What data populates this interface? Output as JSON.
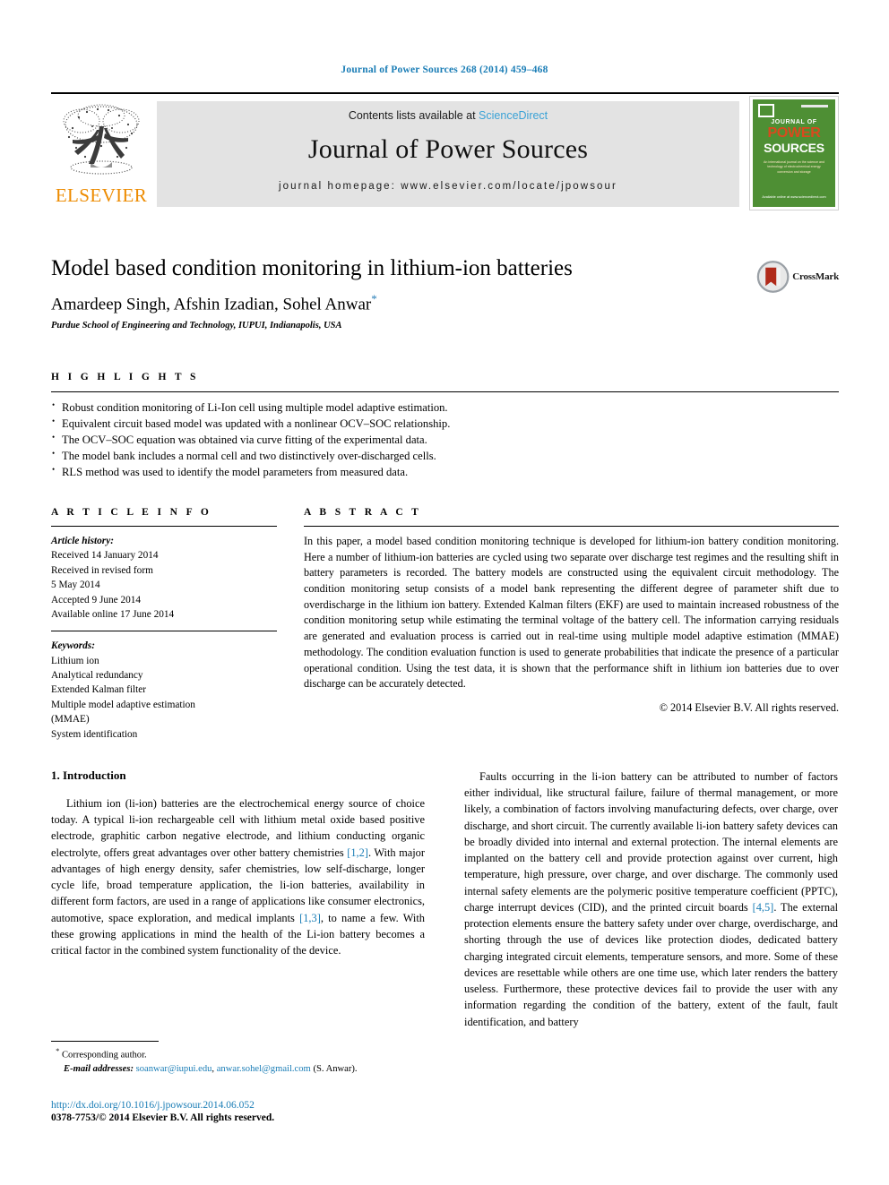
{
  "running_head": "Journal of Power Sources 268 (2014) 459–468",
  "masthead": {
    "contents_prefix": "Contents lists available at ",
    "sciencedirect": "ScienceDirect",
    "journal_name": "Journal of Power Sources",
    "homepage": "journal homepage: www.elsevier.com/locate/jpowsour",
    "publisher_wordmark": "ELSEVIER",
    "publisher_color": "#ED8B00",
    "cover": {
      "journal_word": "JOURNAL OF",
      "power_word": "POWER",
      "sources_word": "SOURCES",
      "blurb": "An international journal on the science and technology of electrochemical energy conversion and storage",
      "footer": "Available online at www.sciencedirect.com",
      "bg_color": "#4e8f34",
      "accent_color": "#d94a1e"
    }
  },
  "title_block": {
    "title": "Model based condition monitoring in lithium-ion batteries",
    "authors": "Amardeep Singh, Afshin Izadian, Sohel Anwar",
    "corresponding_marker": "*",
    "affiliation": "Purdue School of Engineering and Technology, IUPUI, Indianapolis, USA",
    "crossmark_label": "CrossMark"
  },
  "highlights": {
    "heading": "H I G H L I G H T S",
    "items": [
      "Robust condition monitoring of Li-Ion cell using multiple model adaptive estimation.",
      "Equivalent circuit based model was updated with a nonlinear OCV–SOC relationship.",
      "The OCV–SOC equation was obtained via curve fitting of the experimental data.",
      "The model bank includes a normal cell and two distinctively over-discharged cells.",
      "RLS method was used to identify the model parameters from measured data."
    ]
  },
  "article_info": {
    "heading": "A R T I C L E  I N F O",
    "history_label": "Article history:",
    "history": [
      "Received 14 January 2014",
      "Received in revised form",
      "5 May 2014",
      "Accepted 9 June 2014",
      "Available online 17 June 2014"
    ],
    "keywords_label": "Keywords:",
    "keywords": [
      "Lithium ion",
      "Analytical redundancy",
      "Extended Kalman filter",
      "Multiple model adaptive estimation",
      "(MMAE)",
      "System identification"
    ]
  },
  "abstract": {
    "heading": "A B S T R A C T",
    "text": "In this paper, a model based condition monitoring technique is developed for lithium-ion battery condition monitoring. Here a number of lithium-ion batteries are cycled using two separate over discharge test regimes and the resulting shift in battery parameters is recorded. The battery models are constructed using the equivalent circuit methodology. The condition monitoring setup consists of a model bank representing the different degree of parameter shift due to overdischarge in the lithium ion battery. Extended Kalman filters (EKF) are used to maintain increased robustness of the condition monitoring setup while estimating the terminal voltage of the battery cell. The information carrying residuals are generated and evaluation process is carried out in real-time using multiple model adaptive estimation (MMAE) methodology. The condition evaluation function is used to generate probabilities that indicate the presence of a particular operational condition. Using the test data, it is shown that the performance shift in lithium ion batteries due to over discharge can be accurately detected.",
    "copyright": "© 2014 Elsevier B.V. All rights reserved."
  },
  "body": {
    "section_number_title": "1.  Introduction",
    "left_paragraph_part1": "Lithium ion (li-ion) batteries are the electrochemical energy source of choice today. A typical li-ion rechargeable cell with lithium metal oxide based positive electrode, graphitic carbon negative electrode, and lithium conducting organic electrolyte, offers great advantages over other battery chemistries ",
    "left_cite1": "[1,2]",
    "left_paragraph_part2": ". With major advantages of high energy density, safer chemistries, low self-discharge, longer cycle life, broad temperature application, the li-ion batteries, availability in different form factors, are used in a range of applications like consumer electronics, automotive, space exploration, and medical implants ",
    "left_cite2": "[1,3]",
    "left_paragraph_part3": ", to name a few. With these growing applications in mind the health of the Li-ion battery becomes a critical factor in the combined system functionality of the device.",
    "right_paragraph_part1": "Faults occurring in the li-ion battery can be attributed to number of factors either individual, like structural failure, failure of thermal management, or more likely, a combination of factors involving manufacturing defects, over charge, over discharge, and short circuit. The currently available li-ion battery safety devices can be broadly divided into internal and external protection. The internal elements are implanted on the battery cell and provide protection against over current, high temperature, high pressure, over charge, and over discharge. The commonly used internal safety elements are the polymeric positive temperature coefficient (PPTC), charge interrupt devices (CID), and the printed circuit boards ",
    "right_cite1": "[4,5]",
    "right_paragraph_part2": ". The external protection elements ensure the battery safety under over charge, overdischarge, and shorting through the use of devices like protection diodes, dedicated battery charging integrated circuit elements, temperature sensors, and more. Some of these devices are resettable while others are one time use, which later renders the battery useless. Furthermore, these protective devices fail to provide the user with any information regarding the condition of the battery, extent of the fault, fault identification, and battery"
  },
  "footnote": {
    "corresponding_star": "*",
    "corresponding_text": "Corresponding author.",
    "email_label": "E-mail addresses:",
    "email1": "soanwar@iupui.edu",
    "email_sep": ", ",
    "email2": "anwar.sohel@gmail.com",
    "email_suffix": " (S. Anwar)."
  },
  "footer": {
    "doi": "http://dx.doi.org/10.1016/j.jpowsour.2014.06.052",
    "issn_prefix": "0378-7753/",
    "issn_rest": "© 2014 Elsevier B.V. All rights reserved."
  },
  "colors": {
    "link_blue": "#1a7db6",
    "sciencedirect_blue": "#3aa2d6",
    "elsevier_orange": "#ED8B00"
  }
}
